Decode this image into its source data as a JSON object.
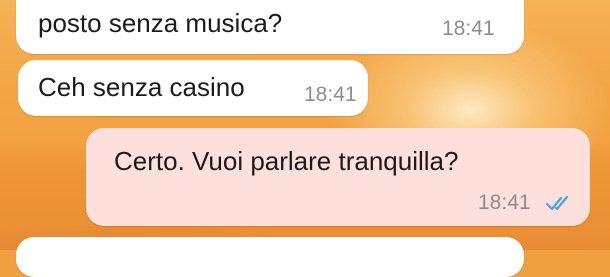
{
  "chat": {
    "messages": [
      {
        "direction": "incoming",
        "text": "posto senza musica?",
        "time": "18:41"
      },
      {
        "direction": "incoming",
        "text": "Ceh senza casino",
        "time": "18:41"
      },
      {
        "direction": "outgoing",
        "text": "Certo. Vuoi parlare tranquilla?",
        "time": "18:41",
        "status_icon": "double-check-icon",
        "status_color": "#4aa3df"
      },
      {
        "direction": "incoming",
        "text": "",
        "time": ""
      }
    ]
  },
  "colors": {
    "incoming_bubble": "#ffffff",
    "outgoing_bubble": "#fde0dc",
    "time_text": "#8e8e8e",
    "read_ticks": "#4aa3df"
  }
}
